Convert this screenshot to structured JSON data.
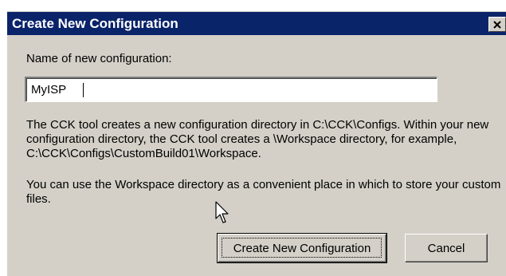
{
  "window": {
    "title": "Create New Configuration",
    "close_icon": "close-icon"
  },
  "form": {
    "name_label": "Name of new configuration:",
    "name_value": "MyISP"
  },
  "info": {
    "paragraph1": "The CCK tool creates a new configuration directory in C:\\CCK\\Configs. Within your new configuration directory, the CCK tool creates a \\Workspace directory, for example, C:\\CCK\\Configs\\CustomBuild01\\Workspace.",
    "paragraph2": "You can use the Workspace directory as a convenient place in which to store your custom files."
  },
  "buttons": {
    "create_label": "Create New Configuration",
    "cancel_label": "Cancel"
  },
  "colors": {
    "titlebar": "#0a246a",
    "dialog_face": "#d4d0c8"
  },
  "icons": {
    "pointer": "mouse-pointer-icon"
  }
}
